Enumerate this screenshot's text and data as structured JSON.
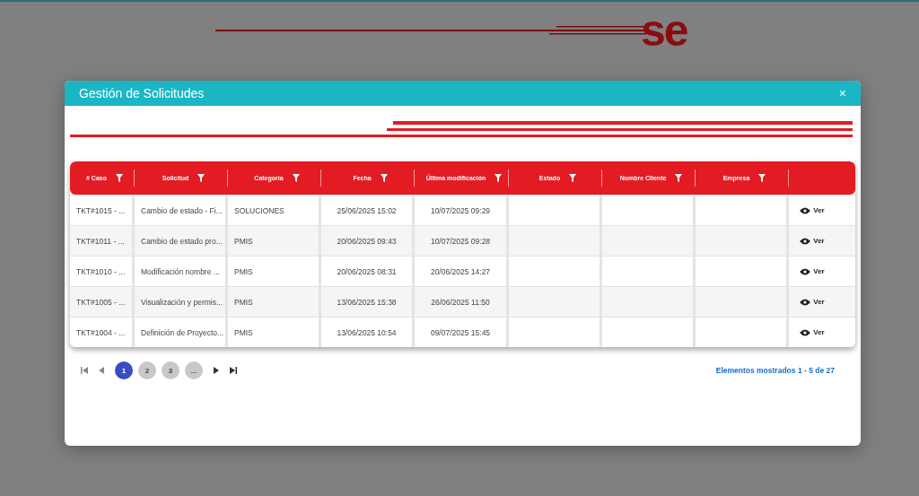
{
  "logo": {
    "text": "se"
  },
  "modal": {
    "title": "Gestión de Solicitudes",
    "close": "×"
  },
  "table": {
    "columns": [
      {
        "label": "# Caso"
      },
      {
        "label": "Solicitud"
      },
      {
        "label": "Categoría"
      },
      {
        "label": "Fecha"
      },
      {
        "label": "Última modificación"
      },
      {
        "label": "Estado"
      },
      {
        "label": "Nombre Cliente"
      },
      {
        "label": "Empresa"
      }
    ],
    "rows": [
      {
        "cells": [
          "TKT#1015 - ...",
          "Cambio de estado - Fi...",
          "SOLUCIONES",
          "25/06/2025 15:02",
          "10/07/2025 09:29",
          "",
          "",
          ""
        ],
        "action": "Ver"
      },
      {
        "cells": [
          "TKT#1011 - ...",
          "Cambio de estado pro...",
          "PMIS",
          "20/06/2025 09:43",
          "10/07/2025 09:28",
          "",
          "",
          ""
        ],
        "action": "Ver"
      },
      {
        "cells": [
          "TKT#1010 - ...",
          "Modificación nombre ...",
          "PMIS",
          "20/06/2025 08:31",
          "20/06/2025 14:27",
          "",
          "",
          ""
        ],
        "action": "Ver"
      },
      {
        "cells": [
          "TKT#1005 - ...",
          "Visualización y permis...",
          "PMIS",
          "13/06/2025 15:38",
          "26/06/2025 11:50",
          "",
          "",
          ""
        ],
        "action": "Ver"
      },
      {
        "cells": [
          "TKT#1004 - ...",
          "Definición de Proyecto...",
          "PMIS",
          "13/06/2025 10:54",
          "09/07/2025 15:45",
          "",
          "",
          ""
        ],
        "action": "Ver"
      }
    ]
  },
  "pagination": {
    "pages": [
      {
        "label": "1",
        "selected": true
      },
      {
        "label": "2",
        "selected": false
      },
      {
        "label": "3",
        "selected": false
      },
      {
        "label": "...",
        "selected": false
      }
    ],
    "summary": "Elementos mostrados 1 - 5 de 27"
  }
}
